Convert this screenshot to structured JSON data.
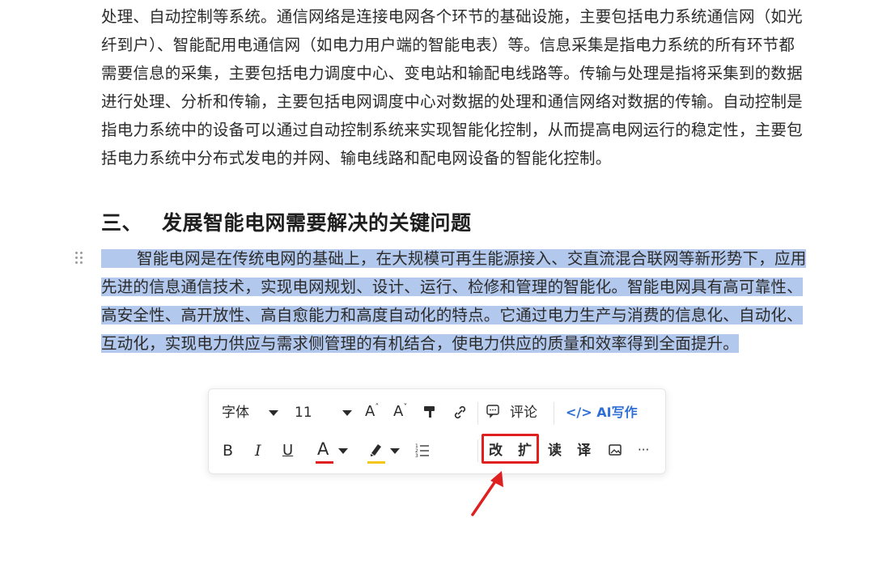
{
  "document": {
    "paragraph1": "处理、自动控制等系统。通信网络是连接电网各个环节的基础设施，主要包括电力系统通信网（如光纤到户）、智能配用电通信网（如电力用户端的智能电表）等。信息采集是指电力系统的所有环节都需要信息的采集，主要包括电力调度中心、变电站和输配电线路等。传输与处理是指将采集到的数据进行处理、分析和传输，主要包括电网调度中心对数据的处理和通信网络对数据的传输。自动控制是指电力系统中的设备可以通过自动控制系统来实现智能化控制，从而提高电网运行的稳定性，主要包括电力系统中分布式发电的并网、输电线路和配电网设备的智能化控制。",
    "heading_number": "三、",
    "heading_text": "发展智能电网需要解决的关键问题",
    "paragraph2": "智能电网是在传统电网的基础上，在大规模可再生能源接入、交直流混合联网等新形势下，应用先进的信息通信技术，实现电网规划、设计、运行、检修和管理的智能化。智能电网具有高可靠性、高安全性、高开放性、高自愈能力和高度自动化的特点。它通过电力生产与消费的信息化、自动化、互动化，实现电力供应与需求侧管理的有机结合，使电力供应的质量和效率得到全面提升。"
  },
  "toolbar": {
    "font_family_label": "字体",
    "font_size_value": "11",
    "increase_font_glyph": "A",
    "decrease_font_glyph": "A",
    "comment_label": "评论",
    "ai_write_label": "</> AI写作",
    "bold_glyph": "B",
    "italic_glyph": "I",
    "underline_glyph": "U",
    "font_color_glyph": "A",
    "rewrite_label": "改",
    "expand_label": "扩",
    "read_label": "读",
    "translate_label": "译",
    "more_glyph": "···"
  },
  "colors": {
    "selection": "#b3c8ed",
    "ai_accent": "#2f6fd6",
    "annotation_red": "#e02020",
    "font_color_underline": "#e02020",
    "highlight_color_underline": "#f5c518"
  }
}
